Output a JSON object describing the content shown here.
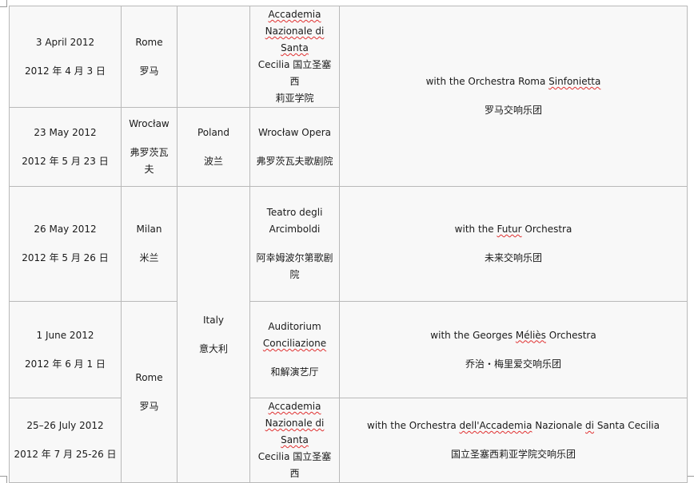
{
  "rows": [
    {
      "date_en": "3 April 2012",
      "date_zh": "2012 年 4 月 3 日",
      "city_en": "Rome",
      "city_zh": "罗马",
      "venue_l1": "Accademia",
      "venue_l2": "Nazionale di Santa",
      "venue_l3a": "Cecilia",
      "venue_l3b": " 国立圣塞西",
      "venue_l4": "莉亚学院"
    },
    {
      "date_en": "23 May 2012",
      "date_zh": "2012 年 5 月 23 日",
      "city_en": "Wrocław",
      "city_zh": "弗罗茨瓦夫",
      "venue_en": "Wrocław Opera",
      "venue_zh": "弗罗茨瓦夫歌剧院"
    },
    {
      "date_en": "26 May 2012",
      "date_zh": "2012 年 5 月 26 日",
      "city_en": "Milan",
      "city_zh": "米兰",
      "venue_l1": "Teatro degli",
      "venue_l2": "Arcimboldi",
      "venue_l3": "阿幸姆波尔第歌剧",
      "venue_l4": "院"
    },
    {
      "date_en": "1 June 2012",
      "date_zh": "2012 年 6 月 1 日",
      "venue_l1": "Auditorium",
      "venue_l2": "Conciliazione",
      "venue_zh": "和解演艺厅"
    },
    {
      "date_en": "25–26 July 2012",
      "date_zh": "2012 年 7 月 25-26 日",
      "venue_l1": "Accademia",
      "venue_l2": "Nazionale di Santa",
      "venue_l3a": "Cecilia",
      "venue_l3b": " 国立圣塞西"
    }
  ],
  "merged": {
    "rome_en": "Rome",
    "rome_zh": "罗马",
    "poland_en": "Poland",
    "poland_zh": "波兰",
    "italy_en": "Italy",
    "italy_zh": "意大利"
  },
  "orchestras": [
    {
      "pre": "with the Orchestra Roma ",
      "mark": "Sinfonietta",
      "post": "",
      "zh": "罗马交响乐团"
    },
    {
      "pre": "with the ",
      "mark": "Futur",
      "post": " Orchestra",
      "zh": "未来交响乐团"
    },
    {
      "pre": "with the Georges ",
      "mark": "Méliès",
      "post": " Orchestra",
      "zh": "乔治・梅里爱交响乐团"
    },
    {
      "pre": "with the Orchestra ",
      "mark": "dell'Accademia",
      "post": " Nazionale ",
      "mark2": "di",
      "post2": " Santa Cecilia",
      "zh": "国立圣塞西莉亚学院交响乐团"
    }
  ]
}
